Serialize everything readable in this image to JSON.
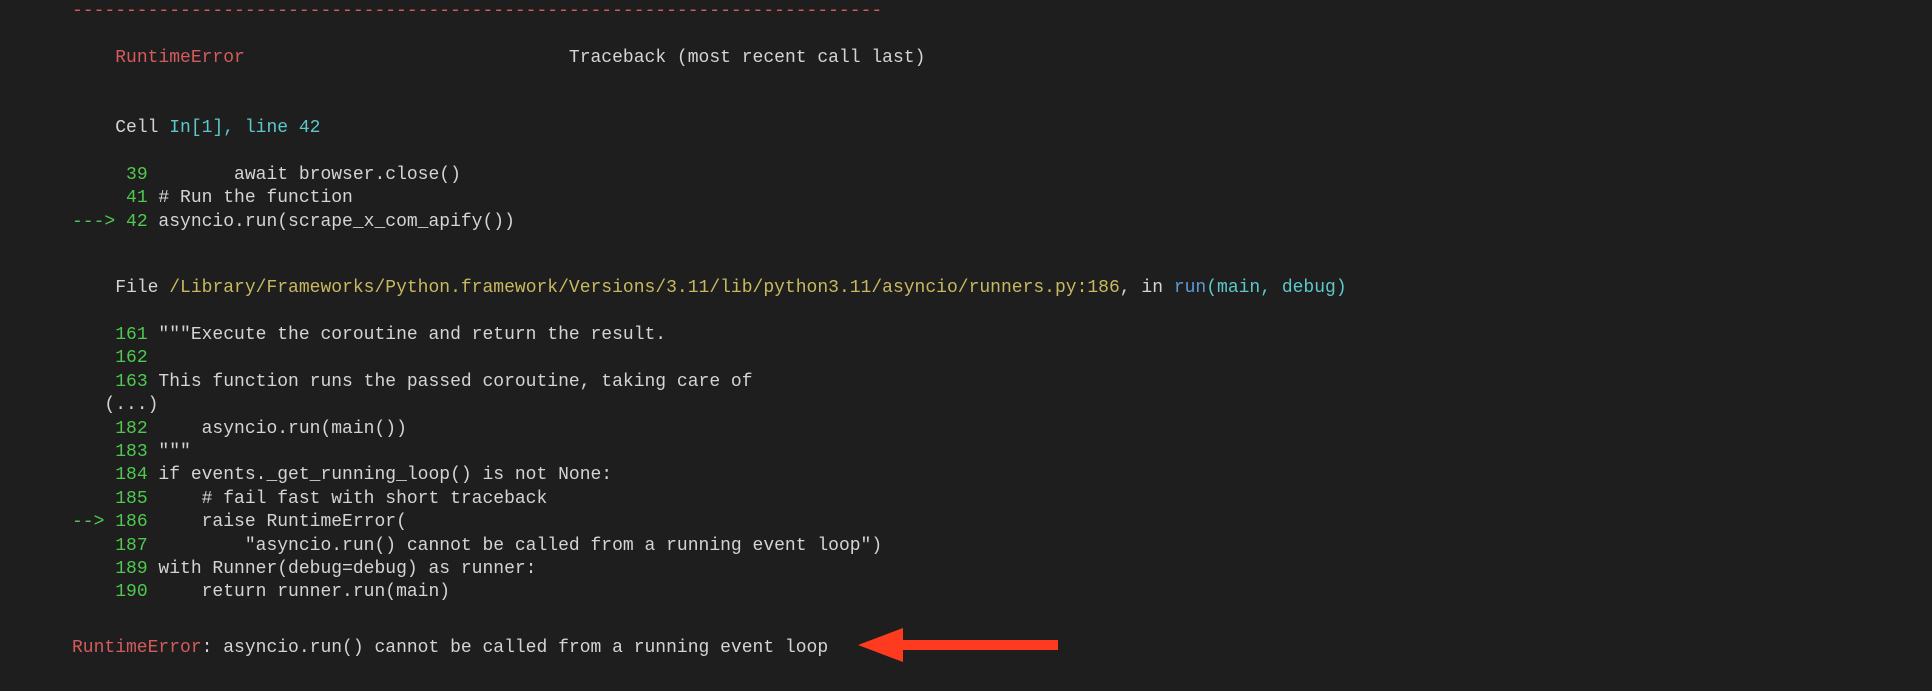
{
  "separator": "---------------------------------------------------------------------------",
  "error_header": {
    "name": "RuntimeError",
    "traceback_label": "Traceback (most recent call last)"
  },
  "cell_header": {
    "prefix": "Cell ",
    "cell_ref": "In[1], line 42"
  },
  "cell_lines": [
    {
      "arrow": "     ",
      "lineno": "39",
      "code": "        await browser.close()"
    },
    {
      "arrow": "     ",
      "lineno": "41",
      "code": " # Run the function"
    },
    {
      "arrow": "---> ",
      "lineno": "42",
      "code": " asyncio.run(scrape_x_com_apify())"
    }
  ],
  "file_header": {
    "prefix": "File ",
    "path": "/Library/Frameworks/Python.framework/Versions/3.11/lib/python3.11/asyncio/runners.py:186",
    "sep": ", in ",
    "func": "run",
    "args_open": "(main, debug)"
  },
  "file_lines": [
    {
      "arrow": "    ",
      "lineno": "161",
      "code": " \"\"\"Execute the coroutine and return the result."
    },
    {
      "arrow": "    ",
      "lineno": "162",
      "code": " "
    },
    {
      "arrow": "    ",
      "lineno": "163",
      "code": " This function runs the passed coroutine, taking care of"
    },
    {
      "arrow": "   ",
      "lineno": "(...)",
      "code": "",
      "is_ellipsis": true
    },
    {
      "arrow": "    ",
      "lineno": "182",
      "code": "     asyncio.run(main())"
    },
    {
      "arrow": "    ",
      "lineno": "183",
      "code": " \"\"\""
    },
    {
      "arrow": "    ",
      "lineno": "184",
      "code": " if events._get_running_loop() is not None:"
    },
    {
      "arrow": "    ",
      "lineno": "185",
      "code": "     # fail fast with short traceback"
    },
    {
      "arrow": "--> ",
      "lineno": "186",
      "code": "     raise RuntimeError("
    },
    {
      "arrow": "    ",
      "lineno": "187",
      "code": "         \"asyncio.run() cannot be called from a running event loop\")"
    },
    {
      "arrow": "    ",
      "lineno": "189",
      "code": " with Runner(debug=debug) as runner:"
    },
    {
      "arrow": "    ",
      "lineno": "190",
      "code": "     return runner.run(main)"
    }
  ],
  "final_error": {
    "name": "RuntimeError",
    "sep": ": ",
    "message": "asyncio.run() cannot be called from a running event loop"
  },
  "arrow_color": "#ff3b1f"
}
